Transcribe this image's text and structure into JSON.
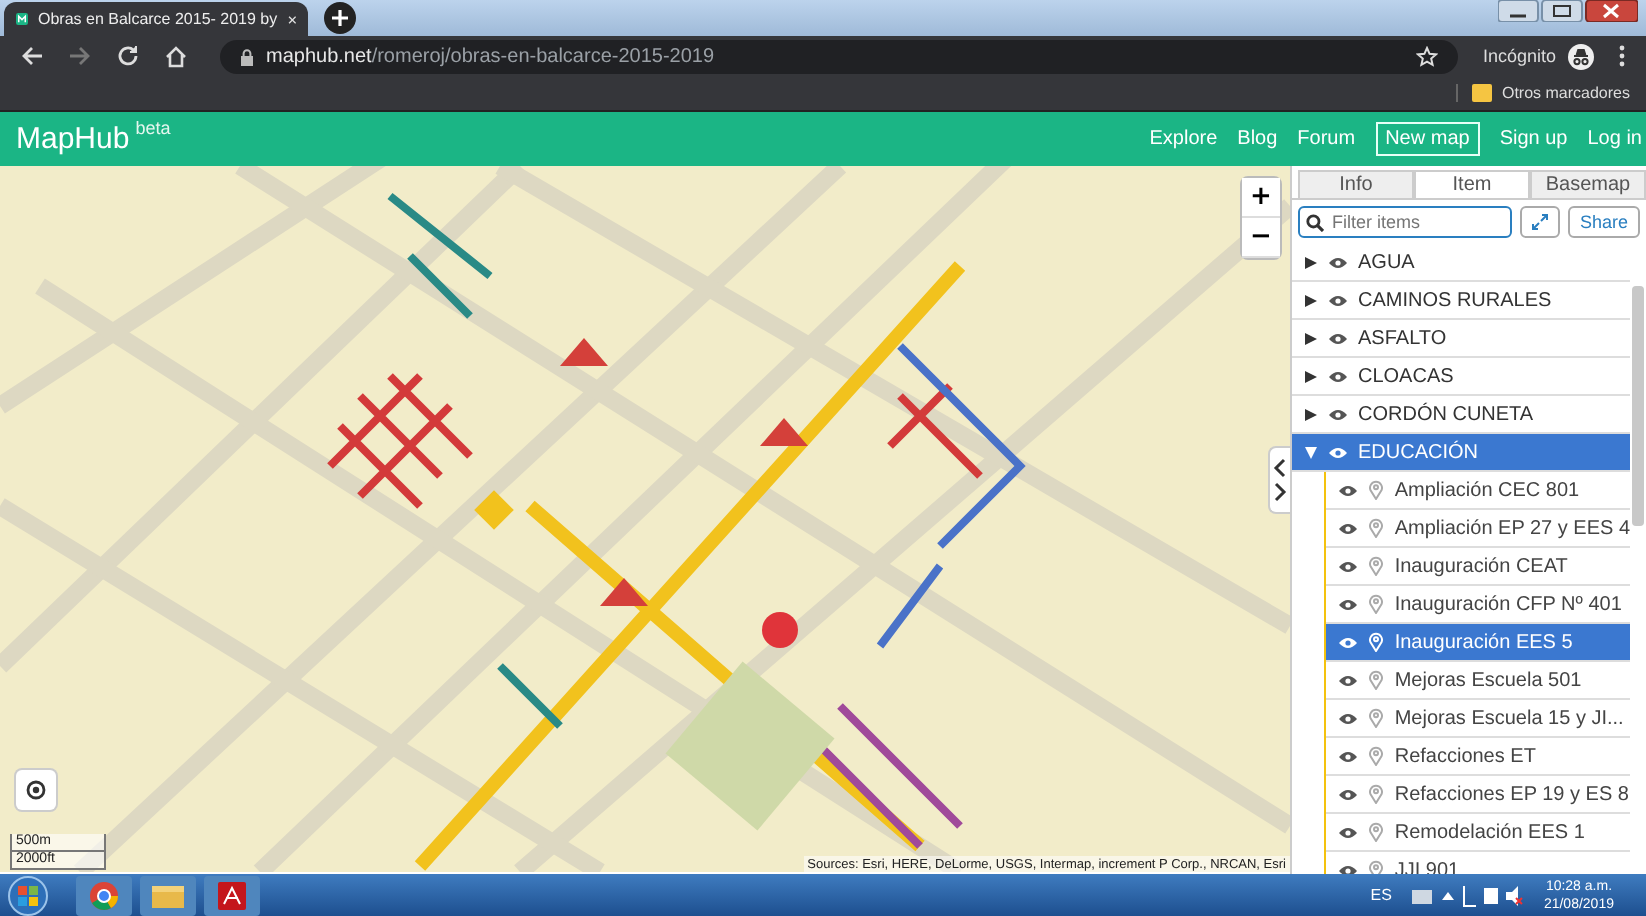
{
  "browser": {
    "tab_title": "Obras en Balcarce 2015- 2019 by",
    "url_host": "maphub.net",
    "url_path": "/romeroj/obras-en-balcarce-2015-2019",
    "profile": "Incógnito",
    "bookmark": "Otros marcadores"
  },
  "header": {
    "logo": "MapHub",
    "badge": "beta",
    "nav": [
      {
        "label": "Explore",
        "kind": "link"
      },
      {
        "label": "Blog",
        "kind": "link"
      },
      {
        "label": "Forum",
        "kind": "link"
      },
      {
        "label": "New map",
        "kind": "button"
      },
      {
        "label": "Sign up",
        "kind": "link"
      },
      {
        "label": "Log in",
        "kind": "link"
      }
    ]
  },
  "map": {
    "zoom_in": "+",
    "zoom_out": "−",
    "scale": [
      "500m",
      "2000ft"
    ],
    "attribution": "Sources: Esri, HERE, DeLorme, USGS, Intermap, increment P Corp., NRCAN, Esri"
  },
  "sidebar": {
    "tabs": [
      {
        "label": "Info",
        "selected": false
      },
      {
        "label": "Item",
        "selected": true
      },
      {
        "label": "Basemap",
        "selected": false
      }
    ],
    "filter": {
      "placeholder": "Filter items"
    },
    "share": "Share",
    "layers": [
      {
        "name": "AGUA",
        "expanded": false,
        "selected": false
      },
      {
        "name": "CAMINOS RURALES",
        "expanded": false,
        "selected": false
      },
      {
        "name": "ASFALTO",
        "expanded": false,
        "selected": false
      },
      {
        "name": "CLOACAS",
        "expanded": false,
        "selected": false
      },
      {
        "name": "CORDÓN CUNETA",
        "expanded": false,
        "selected": false
      },
      {
        "name": "EDUCACIÓN",
        "expanded": true,
        "selected": true,
        "color": "#f4c20d",
        "children": [
          {
            "name": "Ampliación CEC 801",
            "selected": false
          },
          {
            "name": "Ampliación EP 27 y EES 4",
            "selected": false
          },
          {
            "name": "Inauguración CEAT",
            "selected": false
          },
          {
            "name": "Inauguración CFP Nº 401",
            "selected": false
          },
          {
            "name": "Inauguración EES 5",
            "selected": true
          },
          {
            "name": "Mejoras Escuela 501",
            "selected": false
          },
          {
            "name": "Mejoras Escuela 15 y JI...",
            "selected": false
          },
          {
            "name": "Refacciones ET",
            "selected": false
          },
          {
            "name": "Refacciones EP 19 y ES 8",
            "selected": false
          },
          {
            "name": "Remodelación EES 1",
            "selected": false
          },
          {
            "name": "JJI 901",
            "selected": false
          }
        ]
      }
    ]
  },
  "taskbar": {
    "language": "ES",
    "time": "10:28 a.m.",
    "date": "21/08/2019"
  }
}
